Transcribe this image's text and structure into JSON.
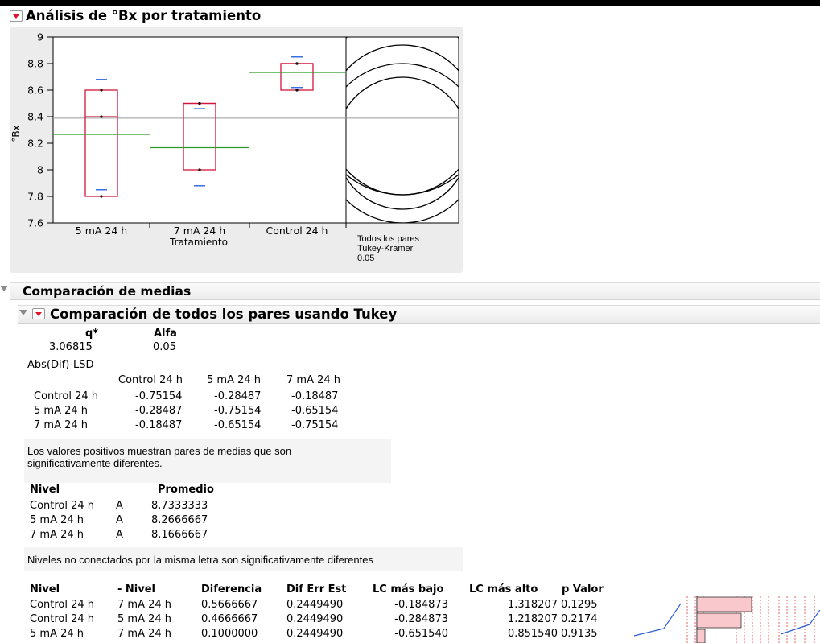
{
  "report": {
    "title": "Análisis de °Bx por tratamiento",
    "y_axis_label": "°Bx",
    "x_axis_label": "Tratamiento",
    "compare_circles_label": [
      "Todos los pares",
      "Tukey-Kramer",
      "0.05"
    ]
  },
  "chart_data": {
    "type": "box",
    "categories": [
      "5 mA 24 h",
      "7 mA 24 h",
      "Control 24 h"
    ],
    "ylim": [
      7.6,
      9.0
    ],
    "y_ticks": [
      "9",
      "8.8",
      "8.6",
      "8.4",
      "8.2",
      "8",
      "7.8",
      "7.6"
    ],
    "grand_mean": 8.3889,
    "groups": [
      {
        "name": "5 mA 24 h",
        "points": [
          7.8,
          8.4,
          8.6
        ],
        "box_min": 7.8,
        "box_q1": 7.8,
        "box_median": 8.4,
        "box_q3": 8.6,
        "box_max": 8.6,
        "mean": 8.2667,
        "ci_upper": 8.68,
        "ci_lower": 7.85
      },
      {
        "name": "7 mA 24 h",
        "points": [
          8.0,
          8.5,
          8.5
        ],
        "box_min": 8.0,
        "box_q1": 8.0,
        "box_median": 8.5,
        "box_q3": 8.5,
        "box_max": 8.5,
        "mean": 8.1667,
        "ci_upper": 8.46,
        "ci_lower": 7.88
      },
      {
        "name": "Control 24 h",
        "points": [
          8.6,
          8.8,
          8.8
        ],
        "box_min": 8.6,
        "box_q1": 8.6,
        "box_median": 8.8,
        "box_q3": 8.8,
        "box_max": 8.8,
        "mean": 8.7333,
        "ci_upper": 8.85,
        "ci_lower": 8.62
      }
    ]
  },
  "comparacion": {
    "title": "Comparación de medias",
    "tukey_title": "Comparación de todos los pares usando Tukey",
    "q_header": "q*",
    "alfa_header": "Alfa",
    "q_value": "3.06815",
    "alfa_value": "0.05",
    "abs_label": "Abs(Dif)-LSD",
    "matrix_headers": [
      "Control 24 h",
      "5 mA 24 h",
      "7 mA 24 h"
    ],
    "matrix_rows": [
      {
        "label": "Control 24 h",
        "values": [
          "-0.75154",
          "-0.28487",
          "-0.18487"
        ]
      },
      {
        "label": "5 mA 24 h",
        "values": [
          "-0.28487",
          "-0.75154",
          "-0.65154"
        ]
      },
      {
        "label": "7 mA 24 h",
        "values": [
          "-0.18487",
          "-0.65154",
          "-0.75154"
        ]
      }
    ],
    "note1_line1": "Los valores positivos muestran pares de medias que son",
    "note1_line2": "significativamente diferentes.",
    "nivel_header": "Nivel",
    "promedio_header": "Promedio",
    "letters_rows": [
      {
        "nivel": "Control 24 h",
        "letter": "A",
        "promedio": "8.7333333"
      },
      {
        "nivel": "5 mA 24 h",
        "letter": "A",
        "promedio": "8.2666667"
      },
      {
        "nivel": "7 mA 24 h",
        "letter": "A",
        "promedio": "8.1666667"
      }
    ],
    "note2": "Niveles no conectados por la misma letra son significativamente diferentes",
    "diff_headers": [
      "Nivel",
      "- Nivel",
      "Diferencia",
      "Dif Err Est",
      "LC más bajo",
      "LC más alto",
      "p Valor"
    ],
    "diff_rows": [
      {
        "nivel": "Control 24 h",
        "menos": "7 mA 24 h",
        "dif": "0.5666667",
        "err": "0.2449490",
        "lo": "-0.184873",
        "hi": "1.318207",
        "p": "0.1295"
      },
      {
        "nivel": "Control 24 h",
        "menos": "5 mA 24 h",
        "dif": "0.4666667",
        "err": "0.2449490",
        "lo": "-0.284873",
        "hi": "1.218207",
        "p": "0.2174"
      },
      {
        "nivel": "5 mA 24 h",
        "menos": "7 mA 24 h",
        "dif": "0.1000000",
        "err": "0.2449490",
        "lo": "-0.651540",
        "hi": "0.851540",
        "p": "0.9135"
      }
    ]
  },
  "colors": {
    "box": "#d3163a",
    "mean_line": "#2e9a2e",
    "ci": "#3a6fe0",
    "grand": "#9a9a9a",
    "bar": "#f9c8cc"
  }
}
